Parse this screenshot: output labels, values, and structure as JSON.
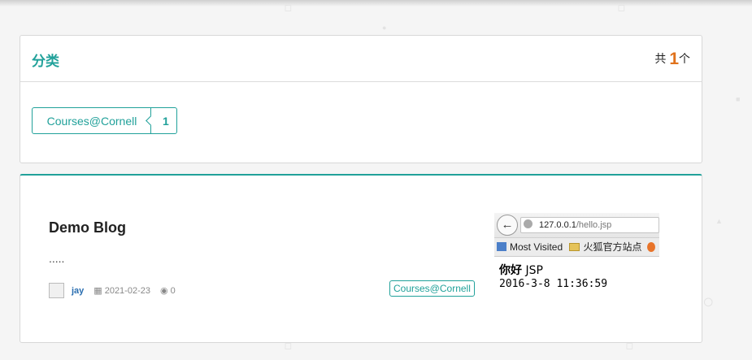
{
  "category_card": {
    "title": "分类",
    "count_prefix": "共",
    "count_value": "1",
    "count_suffix": "个",
    "tags": [
      {
        "name": "Courses@Cornell",
        "count": "1"
      }
    ]
  },
  "blog": {
    "title": "Demo Blog",
    "excerpt": ".....",
    "author": "jay",
    "date": "2021-02-23",
    "views": "0",
    "tag": "Courses@Cornell",
    "thumbnail": {
      "url_host": "127.0.0.1",
      "url_path": "/hello.jsp",
      "bookmark_1": "Most Visited",
      "bookmark_2": "火狐官方站点",
      "page_hello": "你好",
      "page_hello_suffix": "JSP",
      "page_time": "2016-3-8 11:36:59"
    }
  },
  "colors": {
    "accent": "#21a19a",
    "count_highlight": "#e0721c"
  }
}
